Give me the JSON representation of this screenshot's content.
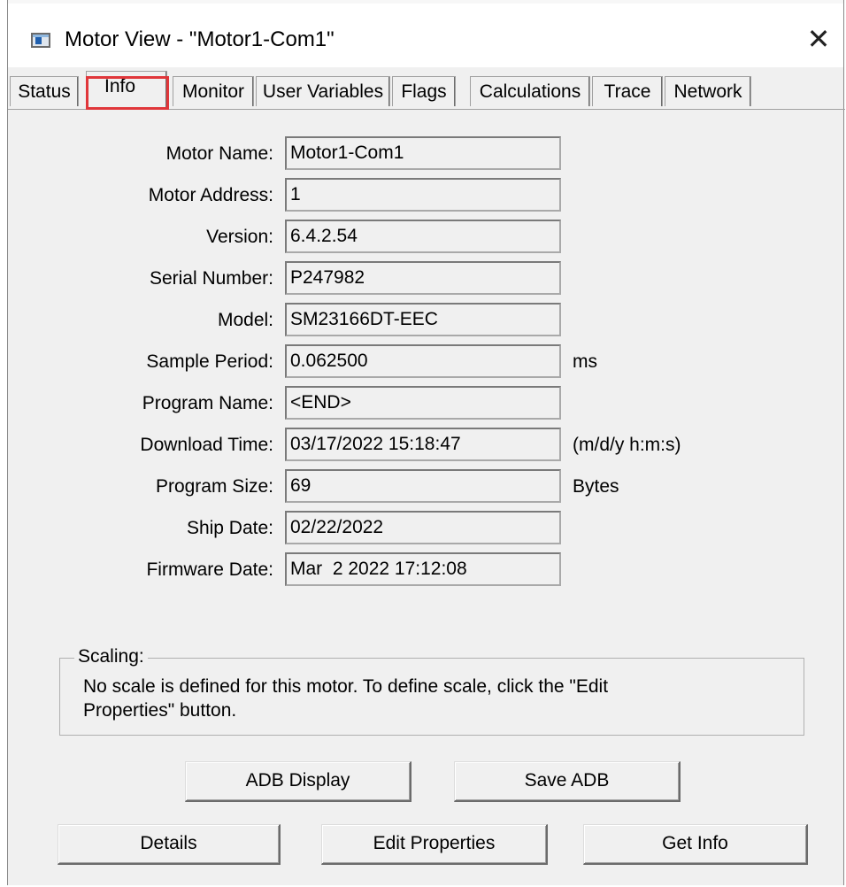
{
  "window": {
    "title": "Motor View - \"Motor1-Com1\"",
    "close_symbol": "✕"
  },
  "tabs": [
    {
      "label": "Status"
    },
    {
      "label": "Info"
    },
    {
      "label": "Monitor"
    },
    {
      "label": "User Variables"
    },
    {
      "label": "Flags"
    },
    {
      "label": "Calculations"
    },
    {
      "label": "Trace"
    },
    {
      "label": "Network"
    }
  ],
  "active_tab": "Info",
  "info": {
    "fields": [
      {
        "label": "Motor Name:",
        "value": "Motor1-Com1",
        "unit": ""
      },
      {
        "label": "Motor Address:",
        "value": "1",
        "unit": ""
      },
      {
        "label": "Version:",
        "value": "6.4.2.54",
        "unit": ""
      },
      {
        "label": "Serial Number:",
        "value": "P247982",
        "unit": ""
      },
      {
        "label": "Model:",
        "value": "SM23166DT-EEC",
        "unit": ""
      },
      {
        "label": "Sample Period:",
        "value": "0.062500",
        "unit": "ms"
      },
      {
        "label": "Program Name:",
        "value": "<END>",
        "unit": ""
      },
      {
        "label": "Download Time:",
        "value": "03/17/2022 15:18:47",
        "unit": "(m/d/y h:m:s)"
      },
      {
        "label": "Program Size:",
        "value": "69",
        "unit": "Bytes"
      },
      {
        "label": "Ship Date:",
        "value": "02/22/2022",
        "unit": ""
      },
      {
        "label": "Firmware Date:",
        "value": "Mar  2 2022 17:12:08",
        "unit": ""
      }
    ]
  },
  "scaling": {
    "title": "Scaling:",
    "text": "No scale is defined for this motor. To define scale, click the \"Edit Properties\" button."
  },
  "buttons": {
    "adb_display": "ADB Display",
    "save_adb": "Save ADB",
    "details": "Details",
    "edit_properties": "Edit Properties",
    "get_info": "Get Info"
  },
  "colors": {
    "highlight": "#e0363a",
    "background": "#f0f0f0"
  }
}
